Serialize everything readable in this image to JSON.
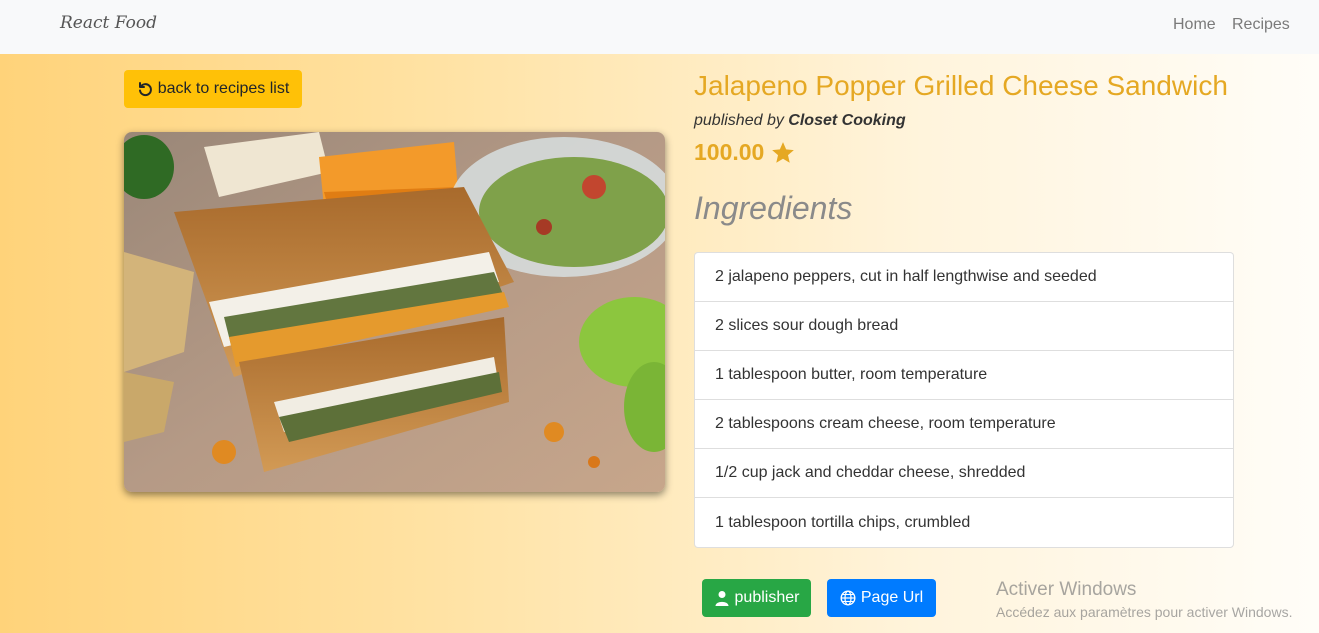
{
  "navbar": {
    "brand": "React Food",
    "links": [
      "Home",
      "Recipes"
    ]
  },
  "back_button": {
    "label": "back to recipes list",
    "icon": "undo-icon"
  },
  "recipe": {
    "title": "Jalapeno Popper Grilled Cheese Sandwich",
    "published_by_prefix": "published by",
    "publisher": "Closet Cooking",
    "rating": "100.00",
    "rating_icon": "star-icon",
    "image_subject": "Jalapeno popper grilled cheese sandwich with guacamole and lime"
  },
  "ingredients": {
    "heading": "Ingredients",
    "items": [
      "2 jalapeno peppers, cut in half lengthwise and seeded",
      "2 slices sour dough bread",
      "1 tablespoon butter, room temperature",
      "2 tablespoons cream cheese, room temperature",
      "1/2 cup jack and cheddar cheese, shredded",
      "1 tablespoon tortilla chips, crumbled"
    ]
  },
  "actions": {
    "publisher_label": "publisher",
    "page_url_label": "Page Url"
  },
  "watermark": {
    "title": "Activer Windows",
    "subtitle": "Accédez aux paramètres pour activer Windows."
  },
  "colors": {
    "accent": "#e5a823",
    "back_button": "#ffc107",
    "publisher_button": "#28a745",
    "url_button": "#007bff"
  }
}
